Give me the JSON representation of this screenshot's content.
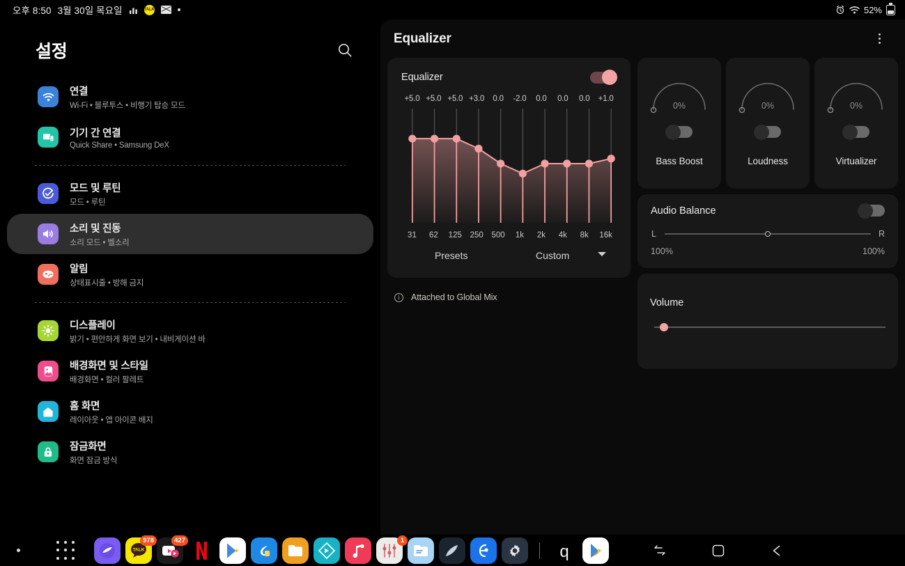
{
  "statusbar": {
    "time": "오후 8:50",
    "date": "3월 30일 목요일",
    "icons": [
      "signal-bars-icon",
      "kakaotalk-icon",
      "mail-icon",
      "dot-icon"
    ],
    "alarm_icon": "alarm-icon",
    "wifi_icon": "wifi-icon",
    "battery_text": "52%",
    "battery_icon": "battery-icon"
  },
  "sidebar": {
    "title": "설정",
    "search_icon": "search-icon",
    "items": [
      {
        "label": "연결",
        "sub": "Wi-Fi  •  블루투스  •  비행기 탑승 모드",
        "icon": "wifi-icon",
        "color": "#3b82d9",
        "selected": false
      },
      {
        "label": "기기 간 연결",
        "sub": "Quick Share  •  Samsung DeX",
        "icon": "devices-icon",
        "color": "#23c4a7",
        "selected": false
      },
      {
        "label": "모드 및 루틴",
        "sub": "모드  •  루틴",
        "icon": "modes-routines-icon",
        "color": "#4a5ad9",
        "selected": false
      },
      {
        "label": "소리 및 진동",
        "sub": "소리 모드  •  벨소리",
        "icon": "sound-icon",
        "color": "#9b7ce0",
        "selected": true
      },
      {
        "label": "알림",
        "sub": "상태표시줄  •  방해 금지",
        "icon": "notifications-icon",
        "color": "#ef6e5c",
        "selected": false
      },
      {
        "label": "디스플레이",
        "sub": "밝기  •  편안하게 화면 보기  •  내비게이션 바",
        "icon": "display-icon",
        "color": "#a6d636",
        "selected": false
      },
      {
        "label": "배경화면 및 스타일",
        "sub": "배경화면  •  컬러 팔레트",
        "icon": "wallpaper-icon",
        "color": "#ee4d8d",
        "selected": false
      },
      {
        "label": "홈 화면",
        "sub": "레이아웃  •  앱 아이콘 배지",
        "icon": "home-screen-icon",
        "color": "#22b5d9",
        "selected": false
      },
      {
        "label": "잠금화면",
        "sub": "화면 잠금 방식",
        "icon": "lock-icon",
        "color": "#1fbb8a",
        "selected": false
      }
    ],
    "divider_after": [
      1,
      4
    ]
  },
  "app": {
    "title": "Equalizer",
    "menu_icon": "kebab-menu-icon",
    "equalizer": {
      "label": "Equalizer",
      "enabled": true,
      "presets_label": "Presets",
      "preset_value": "Custom",
      "caret_icon": "chevron-down-icon"
    },
    "attached_note": "Attached to Global Mix",
    "attached_icon": "info-icon",
    "effects": [
      {
        "name": "Bass Boost",
        "value": "0%",
        "enabled": false
      },
      {
        "name": "Loudness",
        "value": "0%",
        "enabled": false
      },
      {
        "name": "Virtualizer",
        "value": "0%",
        "enabled": false
      }
    ],
    "audio_balance": {
      "title": "Audio Balance",
      "enabled": false,
      "left_label": "L",
      "right_label": "R",
      "left_pct": "100%",
      "right_pct": "100%",
      "position": 50
    },
    "volume": {
      "title": "Volume",
      "position": 4
    }
  },
  "chart_data": {
    "type": "line",
    "title": "Equalizer",
    "categories": [
      "31",
      "62",
      "125",
      "250",
      "500",
      "1k",
      "2k",
      "4k",
      "8k",
      "16k"
    ],
    "values": [
      5.0,
      5.0,
      5.0,
      3.0,
      0.0,
      -2.0,
      0.0,
      0.0,
      0.0,
      1.0
    ],
    "value_labels": [
      "+5.0",
      "+5.0",
      "+5.0",
      "+3.0",
      "0.0",
      "-2.0",
      "0.0",
      "0.0",
      "0.0",
      "+1.0"
    ],
    "xlabel": "",
    "ylabel": "",
    "ylim": [
      -12,
      12
    ],
    "grid": true,
    "legend": "none",
    "line_color": "#f0a0a0"
  },
  "taskbar": {
    "apps": [
      {
        "name": "dot-indicator",
        "badge": ""
      },
      {
        "name": "app-drawer-icon",
        "badge": ""
      },
      {
        "name": "samsung-internet-icon",
        "badge": ""
      },
      {
        "name": "kakaotalk-icon",
        "badge": "978"
      },
      {
        "name": "video-app-icon",
        "badge": "427"
      },
      {
        "name": "netflix-icon",
        "badge": ""
      },
      {
        "name": "play-store-icon",
        "badge": ""
      },
      {
        "name": "blue-app-icon",
        "badge": ""
      },
      {
        "name": "my-files-icon",
        "badge": ""
      },
      {
        "name": "media-app-icon",
        "badge": ""
      },
      {
        "name": "music-app-icon",
        "badge": ""
      },
      {
        "name": "equalizer-app-icon",
        "badge": "1"
      },
      {
        "name": "file-manager-icon",
        "badge": ""
      },
      {
        "name": "dark-app-icon",
        "badge": ""
      },
      {
        "name": "blue-tool-icon",
        "badge": ""
      },
      {
        "name": "settings-icon",
        "badge": ""
      },
      {
        "name": "q-app-icon",
        "badge": ""
      },
      {
        "name": "play-store-icon-2",
        "badge": ""
      }
    ],
    "nav": [
      "recents-icon",
      "home-icon",
      "back-icon"
    ]
  }
}
